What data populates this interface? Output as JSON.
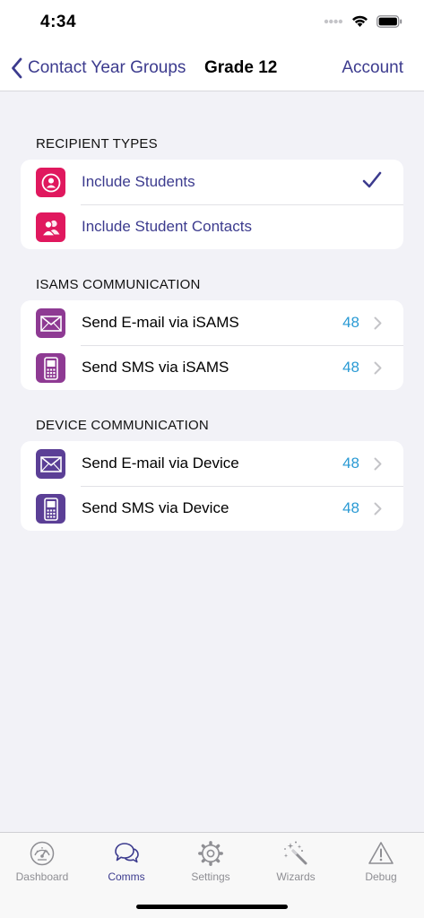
{
  "status_bar": {
    "time": "4:34"
  },
  "nav": {
    "back_label": "Contact Year Groups",
    "title": "Grade 12",
    "right_label": "Account"
  },
  "sections": [
    {
      "header": "RECIPIENT TYPES",
      "rows": [
        {
          "label": "Include Students",
          "icon": "student-icon",
          "checked": true
        },
        {
          "label": "Include Student Contacts",
          "icon": "student-contacts-icon",
          "checked": false
        }
      ]
    },
    {
      "header": "ISAMS COMMUNICATION",
      "rows": [
        {
          "label": "Send E-mail via iSAMS",
          "icon": "envelope-icon",
          "count": "48"
        },
        {
          "label": "Send SMS via iSAMS",
          "icon": "mobile-phone-icon",
          "count": "48"
        }
      ]
    },
    {
      "header": "DEVICE COMMUNICATION",
      "rows": [
        {
          "label": "Send E-mail via Device",
          "icon": "envelope-icon",
          "count": "48"
        },
        {
          "label": "Send SMS via Device",
          "icon": "mobile-phone-icon",
          "count": "48"
        }
      ]
    }
  ],
  "tabs": [
    {
      "label": "Dashboard",
      "icon": "speedometer-icon",
      "active": false
    },
    {
      "label": "Comms",
      "icon": "chat-bubbles-icon",
      "active": true
    },
    {
      "label": "Settings",
      "icon": "gear-icon",
      "active": false
    },
    {
      "label": "Wizards",
      "icon": "magic-wand-icon",
      "active": false
    },
    {
      "label": "Debug",
      "icon": "warning-icon",
      "active": false
    }
  ],
  "colors": {
    "accent": "#3c3b8e",
    "recipient_icon_bg": "#e0185e",
    "isams_icon_bg": "#8e3a93",
    "device_icon_bg": "#5b3f96",
    "count": "#2a9ad4",
    "background": "#f2f2f7"
  }
}
